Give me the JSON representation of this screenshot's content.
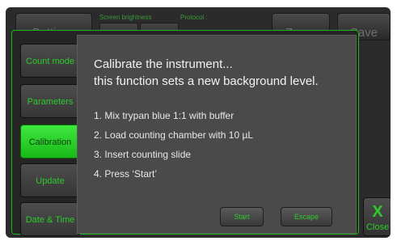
{
  "topbar": {
    "settings_label": "Settings",
    "brightness_label": "Screen brightness",
    "protocol_label": "Protocol :",
    "zoom_label": "Zoom",
    "save_label": "Save"
  },
  "sidebar": {
    "items": [
      {
        "label": "Count mode"
      },
      {
        "label": "Parameters"
      },
      {
        "label": "Calibration",
        "active": true
      },
      {
        "label": "Update"
      },
      {
        "label": "Date & Time"
      }
    ]
  },
  "dialog": {
    "title": "Calibrate the instrument...",
    "subtitle": "this function sets a new background level.",
    "steps": [
      "1. Mix trypan blue 1:1 with buffer",
      "2. Load counting chamber with 10 µL",
      "3. Insert counting slide",
      "4. Press ‘Start’"
    ],
    "start_label": "Start",
    "escape_label": "Escape"
  },
  "close": {
    "icon_glyph": "X",
    "label": "Close"
  },
  "colors": {
    "accent_green": "#1fb51f",
    "active_green": "#3fe83f",
    "dialog_bg": "#4a4a4a"
  }
}
